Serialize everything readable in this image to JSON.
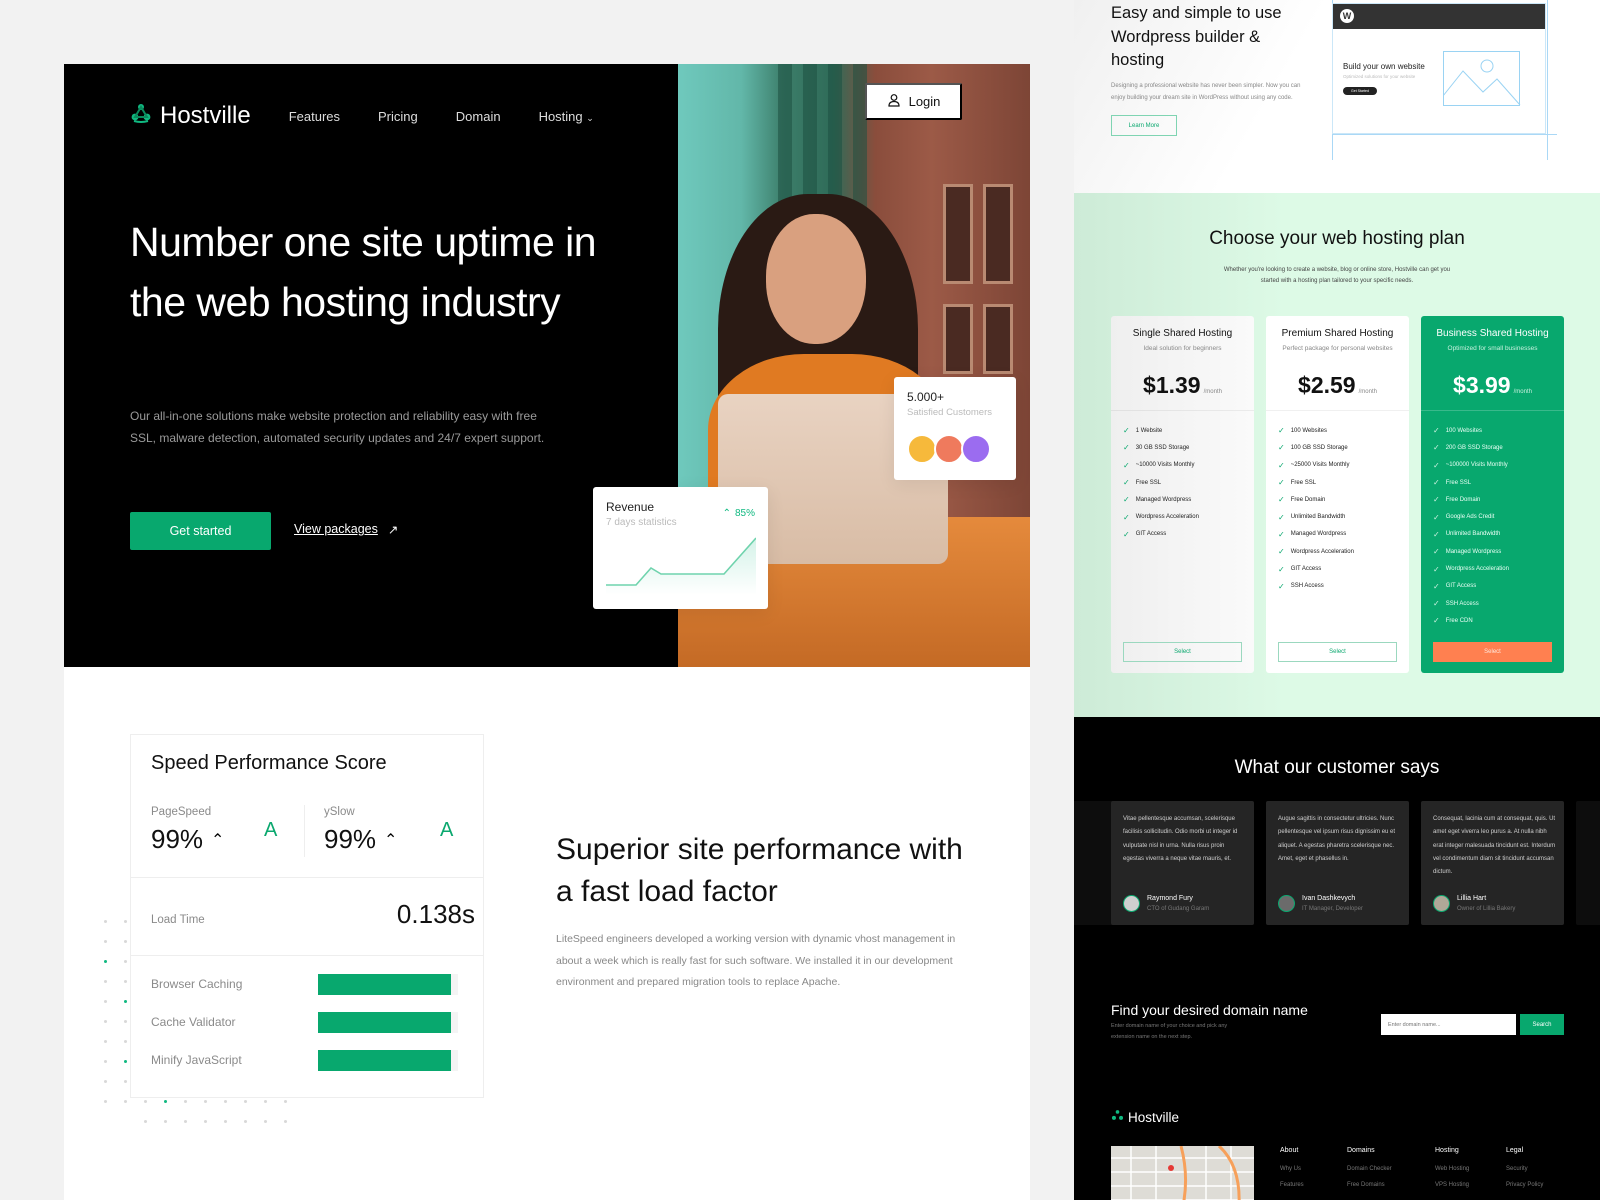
{
  "brand": {
    "name": "Hostville",
    "accent": "#08a86e",
    "accent_orange": "#ff8050"
  },
  "nav": {
    "items": [
      "Features",
      "Pricing",
      "Domain",
      "Hosting"
    ],
    "login_label": "Login"
  },
  "hero": {
    "title": "Number one site uptime in the web hosting industry",
    "description": "Our all-in-one solutions make website protection and reliability easy with free SSL, malware detection, automated security updates and 24/7 expert support.",
    "cta_primary": "Get started",
    "cta_secondary": "View packages",
    "revenue_card": {
      "title": "Revenue",
      "subtitle": "7 days statistics",
      "change": "85%"
    },
    "customers_card": {
      "count": "5.000+",
      "label": "Satisfied Customers"
    }
  },
  "performance": {
    "card_title": "Speed Performance Score",
    "scores": [
      {
        "label": "PageSpeed",
        "value": "99%",
        "grade": "A"
      },
      {
        "label": "ySlow",
        "value": "99%",
        "grade": "A"
      }
    ],
    "load_time_label": "Load Time",
    "load_time_value": "0.138s",
    "metrics": [
      {
        "label": "Browser Caching",
        "percent": 95
      },
      {
        "label": "Cache Validator",
        "percent": 95
      },
      {
        "label": "Minify JavaScript",
        "percent": 95
      }
    ],
    "heading": "Superior site performance with a fast load factor",
    "description": "LiteSpeed engineers developed a working version with dynamic vhost management in about a week which is really fast for such software. We installed it in our development environment and prepared migration tools to replace Apache."
  },
  "wordpress": {
    "title": "Easy and simple to use Wordpress builder & hosting",
    "description": "Designing a professional website has never been simpler. Now you can enjoy building your dream site in WordPress without using any code.",
    "button": "Learn More",
    "mockup": {
      "title": "Build your own website",
      "subtitle": "Optimized solutions for your website",
      "button": "Get Started"
    }
  },
  "pricing": {
    "title": "Choose your web hosting plan",
    "subtitle": "Whether you're looking to create a website, blog or online store, Hostville can get you started with a hosting plan tailored to your specific needs.",
    "plans": [
      {
        "name": "Single Shared Hosting",
        "tagline": "Ideal solution for beginners",
        "price": "$1.39",
        "period": "/month",
        "features": [
          "1 Website",
          "30 GB SSD Storage",
          "~10000 Visits Monthly",
          "Free SSL",
          "Managed Wordpress",
          "Wordpress Acceleration",
          "GIT Access"
        ],
        "button": "Select"
      },
      {
        "name": "Premium Shared Hosting",
        "tagline": "Perfect package for personal websites",
        "price": "$2.59",
        "period": "/month",
        "features": [
          "100 Websites",
          "100 GB SSD Storage",
          "~25000 Visits Monthly",
          "Free SSL",
          "Free Domain",
          "Unlimited Bandwidth",
          "Managed Wordpress",
          "Wordpress Acceleration",
          "GIT Access",
          "SSH Access"
        ],
        "button": "Select"
      },
      {
        "name": "Business Shared Hosting",
        "tagline": "Optimized for small businesses",
        "price": "$3.99",
        "period": "/month",
        "features": [
          "100 Websites",
          "200 GB SSD Storage",
          "~100000 Visits Monthly",
          "Free SSL",
          "Free Domain",
          "Google Ads Credit",
          "Unlimited Bandwidth",
          "Managed Wordpress",
          "Wordpress Acceleration",
          "GIT Access",
          "SSH Access",
          "Free CDN"
        ],
        "button": "Select"
      }
    ]
  },
  "testimonials": {
    "title": "What our customer says",
    "items": [
      {
        "text": "Vitae pellentesque accumsan, scelerisque facilisis sollicitudin. Odio morbi ut integer id vulputate nisl in urna. Nulla risus proin egestas viverra a neque vitae mauris, et.",
        "name": "Raymond Fury",
        "role": "CTO of Gudang Garam"
      },
      {
        "text": "Augue sagittis in consectetur ultricies. Nunc pellentesque vel ipsum risus dignissim eu et aliquet. A egestas pharetra scelerisque nec. Amet, eget et phasellus in.",
        "name": "Ivan Dashkevych",
        "role": "IT Manager, Developer"
      },
      {
        "text": "Consequat, lacinia cum at consequat, quis. Ut amet eget viverra leo purus a. At nulla nibh erat integer malesuada tincidunt est. Interdum vel condimentum diam sit tincidunt accumsan dictum.",
        "name": "Lillia Hart",
        "role": "Owner of Lillia Bakery"
      }
    ]
  },
  "domain": {
    "title": "Find your desired domain name",
    "description": "Enter domain name of your choice and pick any extension name on the next step.",
    "placeholder": "Enter domain name...",
    "button": "Search"
  },
  "footer": {
    "columns": [
      {
        "title": "About",
        "links": [
          "Why Us",
          "Features"
        ]
      },
      {
        "title": "Domains",
        "links": [
          "Domain Checker",
          "Free Domains"
        ]
      },
      {
        "title": "Hosting",
        "links": [
          "Web Hosting",
          "VPS Hosting"
        ]
      },
      {
        "title": "Legal",
        "links": [
          "Security",
          "Privacy Policy"
        ]
      }
    ]
  }
}
